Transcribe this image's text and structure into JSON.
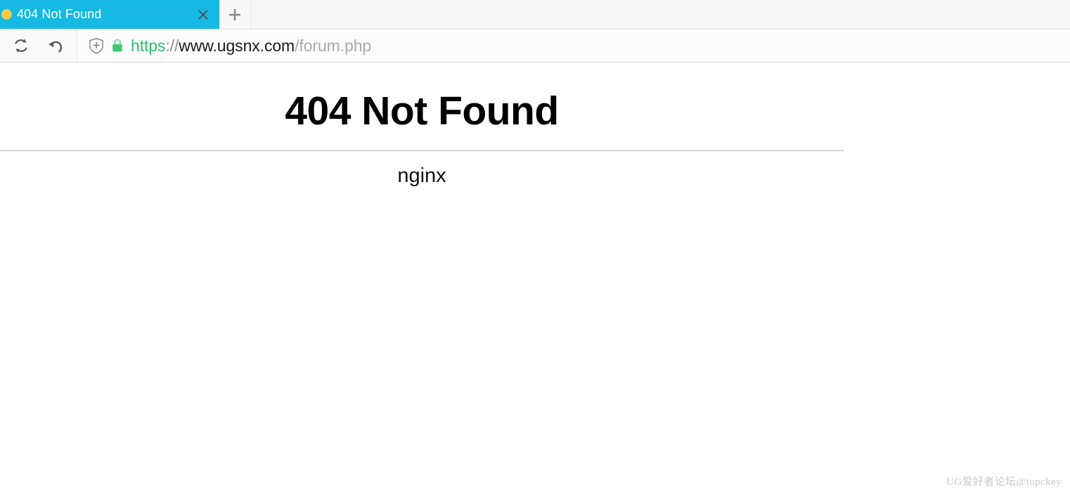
{
  "browser": {
    "tabs": [
      {
        "title": "404 Not Found",
        "favicon": "orange-circle-favicon",
        "close_label": "×",
        "active": true,
        "active_color": "#16b9e3"
      }
    ],
    "new_tab_label": "+",
    "toolbar": {
      "reload_icon": "reload-icon",
      "back_icon": "back-arrow-icon",
      "shield_icon": "shield-plus-icon",
      "lock_icon": "green-padlock-icon",
      "url": {
        "scheme": "https",
        "separator": "://",
        "host": "www.ugsnx.com",
        "path": "/forum.php",
        "full": "https://www.ugsnx.com/forum.php",
        "scheme_color": "#2fbf6d",
        "host_color": "#1a1a1a",
        "path_color": "#a9a9a9"
      }
    }
  },
  "page": {
    "title": "404 Not Found",
    "server_signature": "nginx",
    "divider": "horizontal-rule",
    "background_color": "#ffffff"
  },
  "watermark": {
    "text": "UG爱好者论坛@topckey"
  }
}
